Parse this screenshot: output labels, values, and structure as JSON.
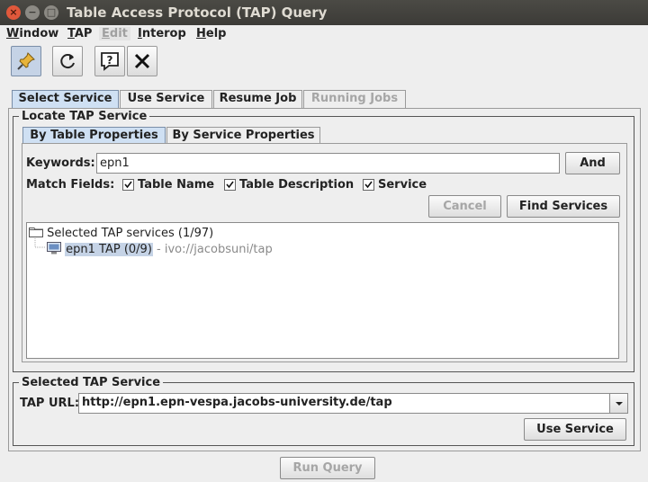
{
  "window": {
    "title": "Table Access Protocol (TAP) Query",
    "controls": {
      "close": "×",
      "minimize": "−",
      "maximize": "□"
    }
  },
  "menubar": {
    "items": [
      {
        "label": "Window",
        "enabled": true
      },
      {
        "label": "TAP",
        "enabled": true
      },
      {
        "label": "Edit",
        "enabled": false
      },
      {
        "label": "Interop",
        "enabled": true
      },
      {
        "label": "Help",
        "enabled": true
      }
    ]
  },
  "toolbar": {
    "buttons": [
      {
        "icon": "pin-icon",
        "active": true
      },
      {
        "icon": "reload-icon",
        "active": false
      },
      {
        "icon": "help-icon",
        "active": false
      },
      {
        "icon": "close-icon",
        "active": false
      }
    ]
  },
  "tabs": [
    {
      "label": "Select Service",
      "selected": true,
      "enabled": true
    },
    {
      "label": "Use Service",
      "selected": false,
      "enabled": true
    },
    {
      "label": "Resume Job",
      "selected": false,
      "enabled": true
    },
    {
      "label": "Running Jobs",
      "selected": false,
      "enabled": false
    }
  ],
  "locate": {
    "legend": "Locate TAP Service",
    "subtabs": [
      {
        "label": "By Table Properties",
        "selected": true
      },
      {
        "label": "By Service Properties",
        "selected": false
      }
    ],
    "keywords_label": "Keywords:",
    "keywords_value": "epn1",
    "and_button": "And",
    "match_fields_label": "Match Fields:",
    "checkboxes": [
      {
        "label": "Table Name",
        "checked": true
      },
      {
        "label": "Table Description",
        "checked": true
      },
      {
        "label": "Service",
        "checked": true
      }
    ],
    "cancel_button": "Cancel",
    "find_button": "Find Services",
    "tree": {
      "root_label": "Selected TAP services (1/97)",
      "child_name": "epn1 TAP (0/9)",
      "child_url": " - ivo://jacobsuni/tap"
    }
  },
  "selected": {
    "legend": "Selected TAP Service",
    "url_label": "TAP URL:",
    "url_value": "http://epn1.epn-vespa.jacobs-university.de/tap",
    "use_button": "Use Service"
  },
  "run_query_button": "Run Query",
  "colors": {
    "tab_selected": "#cfe0f3",
    "titlebar": "#3c3b37",
    "close_button": "#e0583b",
    "selection": "#c5d3e6"
  }
}
